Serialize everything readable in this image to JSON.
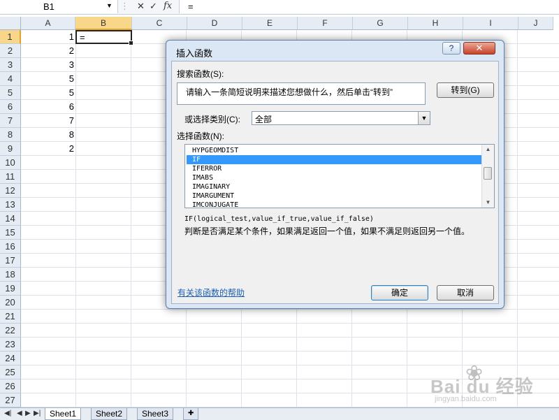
{
  "formula_bar": {
    "name_box": "B1",
    "cancel_symbol": "✕",
    "enter_symbol": "✓",
    "fx_symbol": "fx",
    "content": "="
  },
  "columns": [
    "A",
    "B",
    "C",
    "D",
    "E",
    "F",
    "G",
    "H",
    "I",
    "J"
  ],
  "selected_column": "B",
  "rows": [
    "1",
    "2",
    "3",
    "4",
    "5",
    "6",
    "7",
    "8",
    "9",
    "10",
    "11",
    "12",
    "13",
    "14",
    "15",
    "16",
    "17",
    "18",
    "19",
    "20",
    "21",
    "22",
    "23",
    "24",
    "25",
    "26",
    "27"
  ],
  "selected_row": "1",
  "column_a_values": [
    "1",
    "2",
    "3",
    "5",
    "5",
    "6",
    "7",
    "8",
    "2"
  ],
  "active_cell": {
    "ref": "B1",
    "content": "="
  },
  "sheet_tabs": [
    "Sheet1",
    "Sheet2",
    "Sheet3"
  ],
  "active_sheet": "Sheet1",
  "dialog": {
    "title": "插入函数",
    "help_label": "?",
    "close_label": "✕",
    "search_label": "搜索函数(S):",
    "search_value": "请输入一条简短说明来描述您想做什么，然后单击“转到”",
    "go_button": "转到(G)",
    "category_label": "或选择类别(C):",
    "category_value": "全部",
    "function_list_label": "选择函数(N):",
    "functions": [
      "HYPGEOMDIST",
      "IF",
      "IFERROR",
      "IMABS",
      "IMAGINARY",
      "IMARGUMENT",
      "IMCONJUGATE"
    ],
    "selected_function": "IF",
    "syntax": "IF(logical_test,value_if_true,value_if_false)",
    "description": "判断是否满足某个条件，如果满足返回一个值，如果不满足则返回另一个值。",
    "help_link": "有关该函数的帮助",
    "ok_button": "确定",
    "cancel_button": "取消"
  },
  "watermark": {
    "brand": "Bai du 经验",
    "url": "jingyan.baidu.com"
  },
  "colors": {
    "selection_header": "#f9d78a",
    "list_highlight": "#3399ff",
    "dialog_frame": "#dbe7f5",
    "close_button": "#c8442a"
  }
}
